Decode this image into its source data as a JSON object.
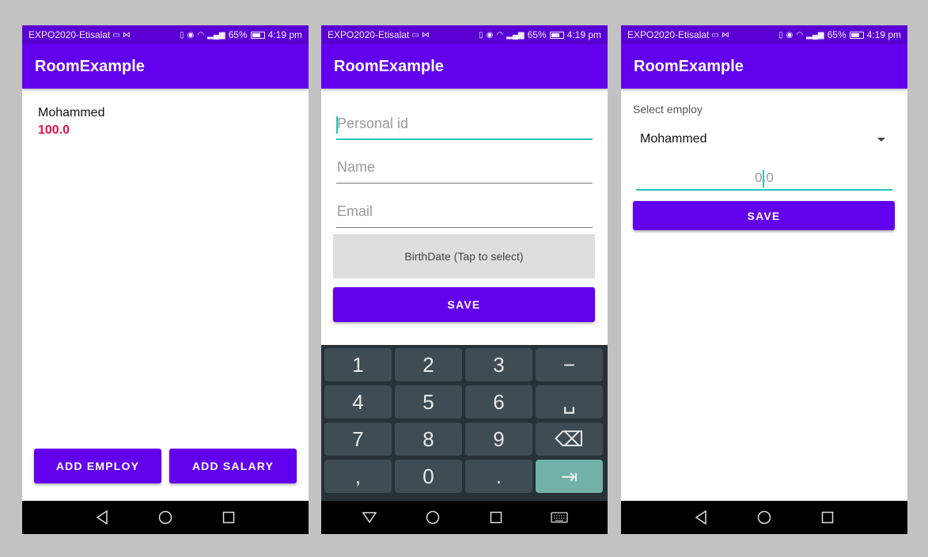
{
  "status": {
    "carrier": "EXPO2020-Etisalat",
    "signal": "65%",
    "time": "4:19 pm"
  },
  "app_title": "RoomExample",
  "screen1": {
    "employee_name": "Mohammed",
    "employee_salary": "100.0",
    "add_employ_label": "ADD EMPLOY",
    "add_salary_label": "ADD SALARY"
  },
  "screen2": {
    "personal_id_placeholder": "Personal id",
    "name_placeholder": "Name",
    "email_placeholder": "Email",
    "birthdate_label": "BirthDate (Tap to select)",
    "save_label": "SAVE",
    "keys": [
      "1",
      "2",
      "3",
      "−",
      "4",
      "5",
      "6",
      "␣",
      "7",
      "8",
      "9",
      "⌫",
      ",",
      "0",
      ".",
      "⇥"
    ]
  },
  "screen3": {
    "select_label": "Select employ",
    "selected_employee": "Mohammed",
    "salary_placeholder": "0.0",
    "save_label": "SAVE"
  },
  "colors": {
    "primary": "#6200ee",
    "status_bar": "#5a00d4",
    "accent": "#26c6b8",
    "salary_text": "#e0144c"
  }
}
